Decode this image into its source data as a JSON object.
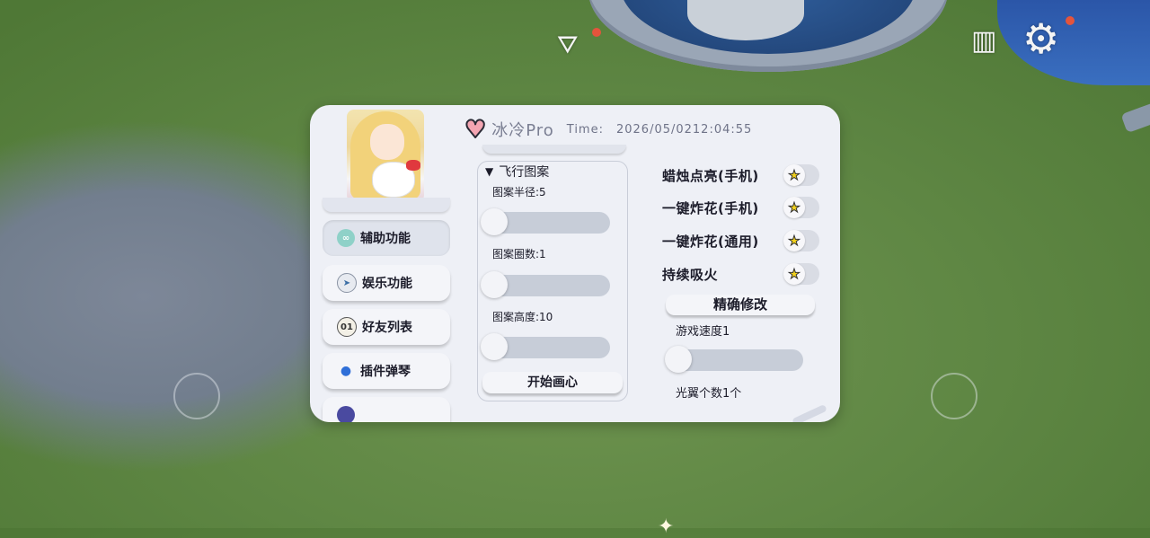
{
  "app": {
    "name": "冰冷Pro",
    "time_label": "Time:",
    "time_value": "2026/05/0212:04:55"
  },
  "nav": {
    "items": [
      {
        "label": "辅助功能",
        "icon": "assist-icon",
        "active": true
      },
      {
        "label": "娱乐功能",
        "icon": "paper-plane-icon",
        "active": false
      },
      {
        "label": "好友列表",
        "icon": "friends-icon",
        "active": false
      },
      {
        "label": "插件弹琴",
        "icon": "location-pin-icon",
        "active": false
      }
    ]
  },
  "flight_pattern": {
    "section_title": "飞行图案",
    "sliders": [
      {
        "label": "图案半径:5",
        "value": 5
      },
      {
        "label": "图案圈数:1",
        "value": 1
      },
      {
        "label": "图案高度:10",
        "value": 10
      }
    ],
    "action_label": "开始画心"
  },
  "toggles": [
    {
      "label": "蜡烛点亮(手机)",
      "on": false
    },
    {
      "label": "一键炸花(手机)",
      "on": false
    },
    {
      "label": "一键炸花(通用)",
      "on": false
    },
    {
      "label": "持续吸火",
      "on": false
    }
  ],
  "precise": {
    "button_label": "精确修改",
    "speed_label": "游戏速度1",
    "speed_value": 1,
    "wings_label": "光翼个数1个"
  },
  "colors": {
    "panel_bg": "#eef0f6",
    "accent_text": "#7b7f93",
    "star": "#f3d21c",
    "notification": "#e4543c"
  }
}
